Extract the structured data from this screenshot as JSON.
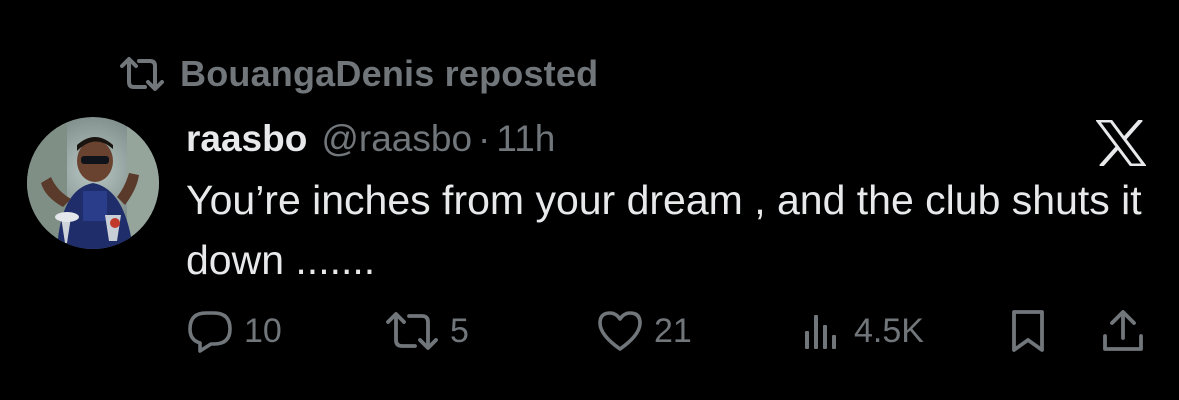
{
  "repost_banner": {
    "icon": "repost-icon",
    "text": "BouangaDenis reposted"
  },
  "tweet": {
    "author_name": "raasbo",
    "handle": "@raasbo",
    "separator": "·",
    "time": "11h",
    "text": "You’re inches from your dream , and the club shuts it down .......",
    "avatar_icon": "avatar"
  },
  "actions": {
    "reply": {
      "icon": "reply-icon",
      "count": "10"
    },
    "retweet": {
      "icon": "retweet-icon",
      "count": "5"
    },
    "like": {
      "icon": "heart-icon",
      "count": "21"
    },
    "views": {
      "icon": "views-icon",
      "count": "4.5K"
    },
    "bookmark": {
      "icon": "bookmark-icon"
    },
    "share": {
      "icon": "share-icon"
    }
  },
  "brand": {
    "icon": "x-logo-icon"
  },
  "colors": {
    "background": "#000000",
    "primary_text": "#e7e9ea",
    "secondary_text": "#71767b"
  }
}
